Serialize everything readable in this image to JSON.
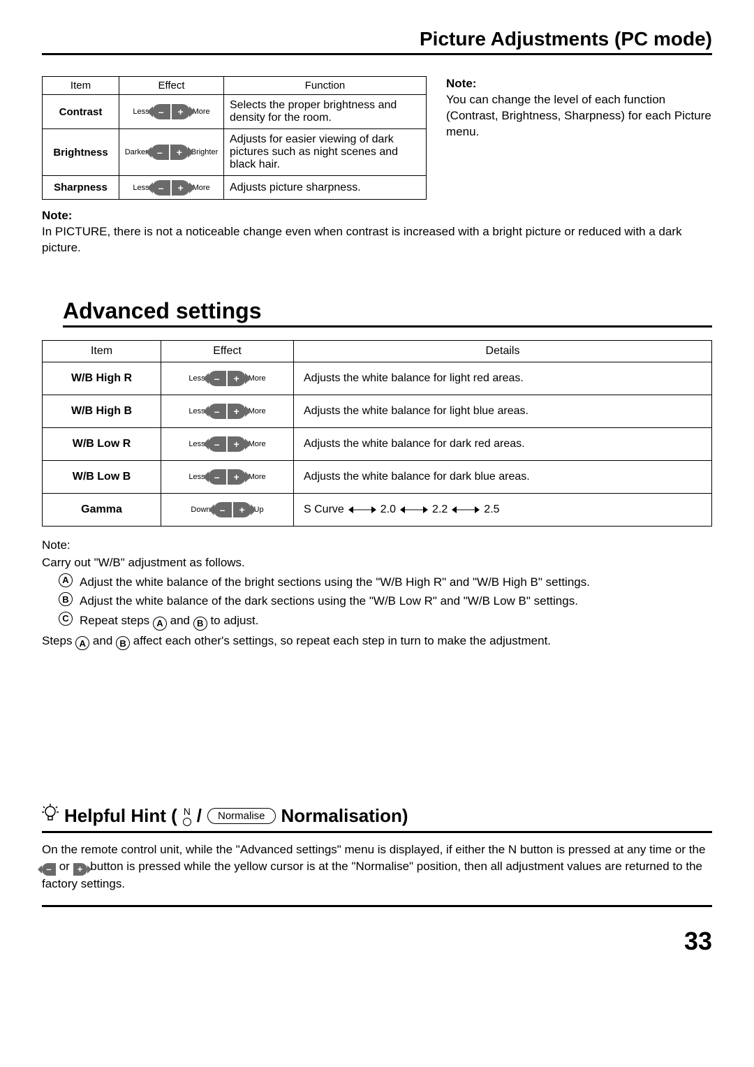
{
  "page_title": "Picture Adjustments (PC mode)",
  "table1": {
    "headers": {
      "item": "Item",
      "effect": "Effect",
      "function": "Function"
    },
    "rows": [
      {
        "item": "Contrast",
        "left": "Less",
        "right": "More",
        "function": "Selects the proper brightness and density for the room."
      },
      {
        "item": "Brightness",
        "left": "Darker",
        "right": "Brighter",
        "function": "Adjusts for easier viewing of dark pictures such as night scenes and black hair."
      },
      {
        "item": "Sharpness",
        "left": "Less",
        "right": "More",
        "function": "Adjusts picture sharpness."
      }
    ]
  },
  "side_note": {
    "label": "Note:",
    "text": "You can change the level of each function (Contrast, Brightness, Sharpness) for each Picture menu."
  },
  "note1": {
    "label": "Note:",
    "text": "In PICTURE, there is not a noticeable change even when contrast is increased with a bright picture or reduced with a dark picture."
  },
  "advanced_title": "Advanced settings",
  "table2": {
    "headers": {
      "item": "Item",
      "effect": "Effect",
      "details": "Details"
    },
    "rows": [
      {
        "item": "W/B High R",
        "left": "Less",
        "right": "More",
        "details": "Adjusts the white balance for light red areas."
      },
      {
        "item": "W/B High B",
        "left": "Less",
        "right": "More",
        "details": "Adjusts the white balance for light blue areas."
      },
      {
        "item": "W/B Low R",
        "left": "Less",
        "right": "More",
        "details": "Adjusts the white balance for dark red areas."
      },
      {
        "item": "W/B Low B",
        "left": "Less",
        "right": "More",
        "details": "Adjusts the white balance for dark blue areas."
      },
      {
        "item": "Gamma",
        "left": "Down",
        "right": "Up",
        "details_seq": [
          "S Curve",
          "2.0",
          "2.2",
          "2.5"
        ]
      }
    ]
  },
  "note2": {
    "label": "Note:",
    "intro": "Carry out \"W/B\" adjustment as follows.",
    "steps": {
      "A": "Adjust the white balance of the bright sections using the \"W/B High R\" and \"W/B High B\" settings.",
      "B": "Adjust the white balance of the dark sections using the \"W/B Low R\" and \"W/B Low B\" settings.",
      "C_prefix": "Repeat steps ",
      "C_mid": " and ",
      "C_suffix": " to adjust."
    },
    "outro_1": "Steps ",
    "outro_2": " and ",
    "outro_3": " affect each other's settings, so repeat each step in turn to make the adjustment."
  },
  "hint": {
    "title_prefix": "Helpful Hint (",
    "n_label": "N",
    "slash": " / ",
    "normalise_btn": "Normalise",
    "title_suffix": " Normalisation)",
    "body_1": "On the remote control unit, while the \"Advanced settings\" menu is displayed, if either the N button is pressed at any time or the ",
    "body_or": " or ",
    "body_2": " button is pressed while the yellow cursor is at the \"Normalise\" position, then all adjustment values are returned to the factory settings."
  },
  "page_number": "33"
}
